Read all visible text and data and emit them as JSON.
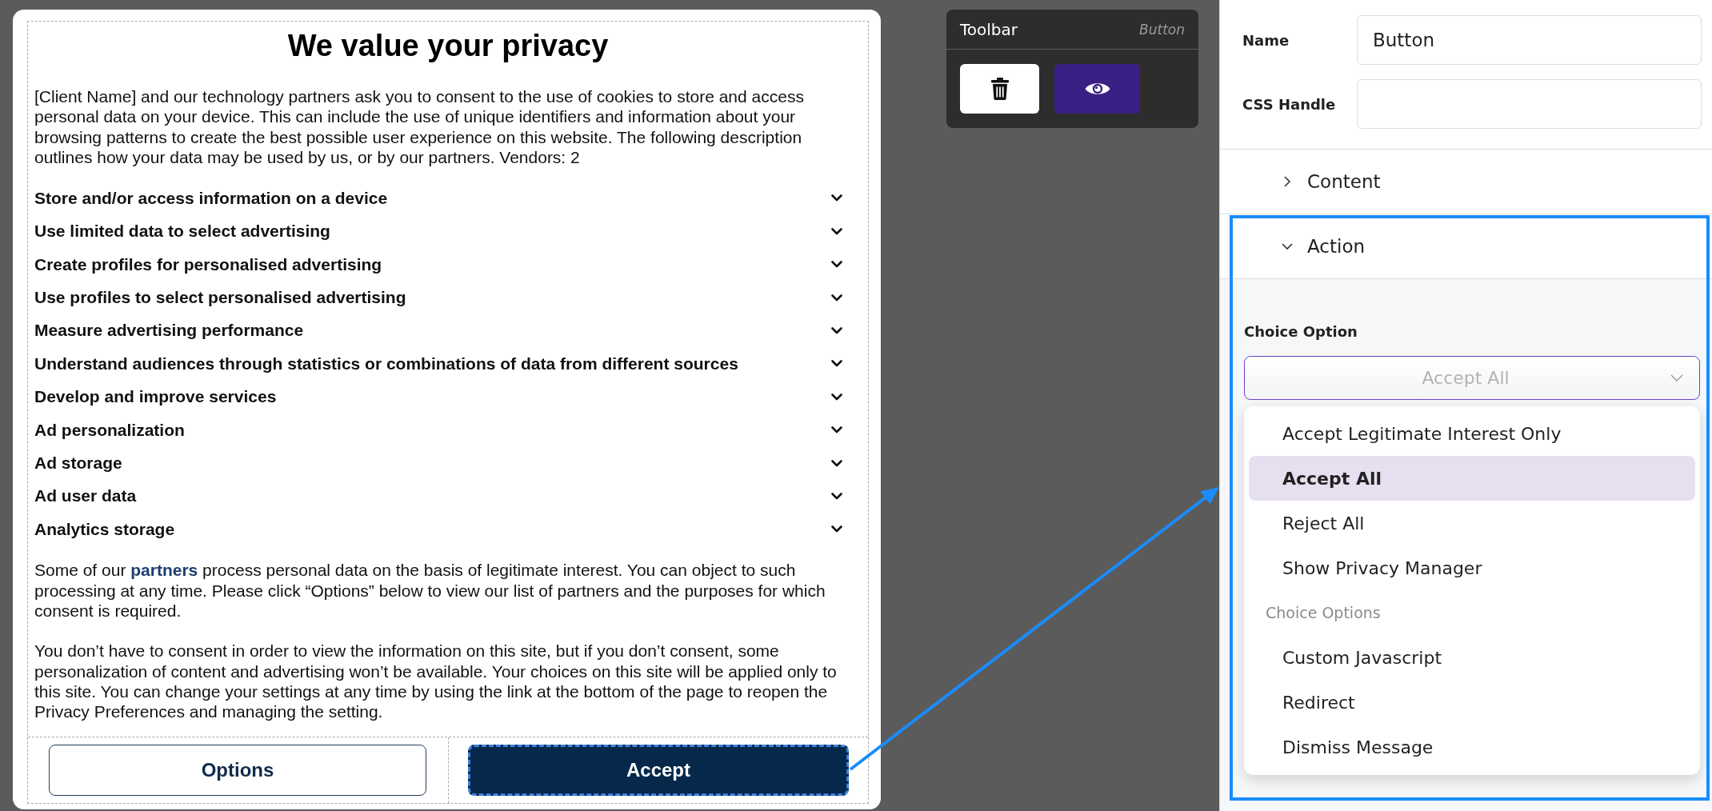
{
  "consent_dialog": {
    "title": "We value your privacy",
    "intro": "[Client Name] and our technology partners ask you to consent to the use of cookies to store and access personal data on your device. This can include the use of unique identifiers and information about your browsing patterns to create the best possible user experience on this website. The following description outlines how your data may be used by us, or by our partners. Vendors: 2",
    "purposes": [
      {
        "label": "Store and/or access information on a device",
        "expanded": false
      },
      {
        "label": "Use limited data to select advertising",
        "expanded": false
      },
      {
        "label": "Create profiles for personalised advertising",
        "expanded": false
      },
      {
        "label": "Use profiles to select personalised advertising",
        "expanded": false
      },
      {
        "label": "Measure advertising performance",
        "expanded": false
      },
      {
        "label": "Understand audiences through statistics or combinations of data from different sources",
        "expanded": false
      },
      {
        "label": "Develop and improve services",
        "expanded": false
      },
      {
        "label": "Ad personalization",
        "expanded": false
      },
      {
        "label": "Ad storage",
        "expanded": false
      },
      {
        "label": "Ad user data",
        "expanded": false
      },
      {
        "label": "Analytics storage",
        "expanded": false
      }
    ],
    "legitimate_interest_notice": {
      "before": "Some of our ",
      "link": "partners",
      "after": " process personal data on the basis of legitimate interest. You can object to such processing at any time. Please click “Options” below to view our list of partners and the purposes for which consent is required."
    },
    "consent_notice": "You don’t have to consent in order to view the information on this site, but if you don’t consent, some personalization of content and advertising won’t be available. Your choices on this site will be applied only to this site. You can change your settings at any time by using the link at the bottom of the page to reopen the Privacy Preferences and managing the setting.",
    "buttons": [
      {
        "kind": "secondary",
        "label": "Options",
        "selected": false
      },
      {
        "kind": "primary",
        "label": "Accept",
        "selected": true
      }
    ]
  },
  "toolbar": {
    "title": "Toolbar",
    "element_type": "Button",
    "actions": [
      {
        "kind": "delete"
      },
      {
        "kind": "preview"
      }
    ]
  },
  "properties_panel": {
    "fields": [
      {
        "label": "Name",
        "value": "Button"
      },
      {
        "label": "CSS Handle"
      }
    ],
    "sections": [
      {
        "title": "Content",
        "expanded": false,
        "highlighted": false
      },
      {
        "title": "Action",
        "expanded": true,
        "highlighted": true,
        "choice_option": {
          "label": "Choice Option",
          "value": "Accept All",
          "open": true,
          "options": [
            {
              "label": "Accept Legitimate Interest Only",
              "selected": false
            },
            {
              "label": "Accept All",
              "selected": true
            },
            {
              "label": "Reject All",
              "selected": false
            },
            {
              "label": "Show Privacy Manager",
              "selected": false
            }
          ],
          "option_groups": [
            {
              "heading": "Choice Options",
              "options": [
                {
                  "label": "Custom Javascript",
                  "selected": false
                },
                {
                  "label": "Redirect",
                  "selected": false
                },
                {
                  "label": "Dismiss Message",
                  "selected": false
                }
              ]
            }
          ]
        }
      }
    ]
  }
}
